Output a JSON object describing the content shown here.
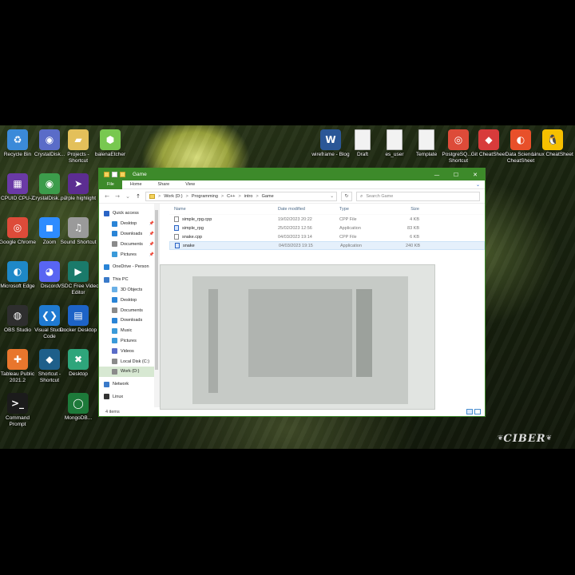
{
  "desktop": {
    "left_icons": [
      {
        "label": "Recycle Bin",
        "color": "#3b8ad9",
        "glyph": "♻"
      },
      {
        "label": "CrystalDisk...",
        "color": "#5a6cc8",
        "glyph": "◉"
      },
      {
        "label": "Projects - Shortcut",
        "color": "#e3c05a",
        "glyph": "▰"
      },
      {
        "label": "balenaEtcher",
        "color": "#78c850",
        "glyph": "⬢"
      },
      {
        "label": "CPUID CPU-Z",
        "color": "#6a3aa6",
        "glyph": "▦"
      },
      {
        "label": "CrystalDisk... 7",
        "color": "#3c9c4b",
        "glyph": "◉"
      },
      {
        "label": "purple highlight",
        "color": "#5c2d91",
        "glyph": "➤"
      },
      {
        "label": "Google Chrome",
        "color": "#dd4b39",
        "glyph": "◎"
      },
      {
        "label": "Zoom",
        "color": "#2d8cff",
        "glyph": "◼"
      },
      {
        "label": "Sound Shortcut",
        "color": "#9a9a9a",
        "glyph": "♫"
      },
      {
        "label": "Microsoft Edge",
        "color": "#1e88c8",
        "glyph": "◐"
      },
      {
        "label": "Discord",
        "color": "#5865f2",
        "glyph": "◕"
      },
      {
        "label": "VSDC Free Video Editor",
        "color": "#1a7a6a",
        "glyph": "▶"
      },
      {
        "label": "OBS Studio",
        "color": "#2e2e2e",
        "glyph": "◍"
      },
      {
        "label": "Visual Studio Code",
        "color": "#1f7ad1",
        "glyph": "❮❯"
      },
      {
        "label": "Docker Desktop",
        "color": "#1d63c7",
        "glyph": "▤"
      },
      {
        "label": "Tableau Public 2021.2",
        "color": "#e8762d",
        "glyph": "✚"
      },
      {
        "label": "Shortcut - Shortcut",
        "color": "#1e5f8a",
        "glyph": "◆"
      },
      {
        "label": "Desktop",
        "color": "#2ea57b",
        "glyph": "✖"
      },
      {
        "label": "Command Prompt",
        "color": "#1b1b1b",
        "glyph": ">_"
      },
      {
        "label": "MongoDB...",
        "color": "#1d7a3a",
        "glyph": "◯"
      }
    ],
    "right_icons": [
      {
        "label": "wireframe - Blog",
        "color": "#2b5797",
        "glyph": "W"
      },
      {
        "label": "Draft",
        "color": "#f2f2f2",
        "glyph": ""
      },
      {
        "label": "es_user",
        "color": "#f2f2f2",
        "glyph": ""
      },
      {
        "label": "Template",
        "color": "#f2f2f2",
        "glyph": ""
      },
      {
        "label": "PostgreSQ... - Shortcut",
        "color": "#dd4b39",
        "glyph": "◎"
      },
      {
        "label": "Git CheatSheet",
        "color": "#d83b3b",
        "glyph": "◆"
      },
      {
        "label": "Data Science CheatSheet",
        "color": "#e8502a",
        "glyph": "◐"
      },
      {
        "label": "Linux CheatSheet",
        "color": "#f6c000",
        "glyph": "🐧"
      }
    ],
    "watermark": "CIBER"
  },
  "window": {
    "title": "Game",
    "controls": {
      "minimize": "—",
      "maximize": "☐",
      "close": "✕"
    },
    "ribbon": {
      "file": "File",
      "home": "Home",
      "share": "Share",
      "view": "View",
      "expand": "⌄"
    },
    "address": {
      "back": "←",
      "forward": "→",
      "recent": "⌄",
      "up": "↑",
      "crumbs": [
        "Work (D:)",
        "Programming",
        "C++",
        "intro",
        "Game"
      ],
      "separator": ">",
      "dropdown": "⌄",
      "refresh": "↻",
      "search_icon": "⌕",
      "search_placeholder": "Search Game"
    },
    "nav_pane": [
      {
        "label": "Quick access",
        "color": "#2a64c5",
        "pinned": false,
        "indent": 0,
        "selected": false
      },
      {
        "label": "Desktop",
        "color": "#2a84d6",
        "pinned": true,
        "indent": 1,
        "selected": false
      },
      {
        "label": "Downloads",
        "color": "#2a84d6",
        "pinned": true,
        "indent": 1,
        "selected": false
      },
      {
        "label": "Documents",
        "color": "#8a8a8a",
        "pinned": true,
        "indent": 1,
        "selected": false
      },
      {
        "label": "Pictures",
        "color": "#3a9ad9",
        "pinned": true,
        "indent": 1,
        "selected": false
      },
      {
        "label": "OneDrive - Person",
        "color": "#2a84d6",
        "pinned": false,
        "indent": 0,
        "selected": false
      },
      {
        "label": "This PC",
        "color": "#3a7ac9",
        "pinned": false,
        "indent": 0,
        "selected": false
      },
      {
        "label": "3D Objects",
        "color": "#6ab0e6",
        "pinned": false,
        "indent": 1,
        "selected": false
      },
      {
        "label": "Desktop",
        "color": "#2a84d6",
        "pinned": false,
        "indent": 1,
        "selected": false
      },
      {
        "label": "Documents",
        "color": "#8a8a8a",
        "pinned": false,
        "indent": 1,
        "selected": false
      },
      {
        "label": "Downloads",
        "color": "#2a84d6",
        "pinned": false,
        "indent": 1,
        "selected": false
      },
      {
        "label": "Music",
        "color": "#3a9ad9",
        "pinned": false,
        "indent": 1,
        "selected": false
      },
      {
        "label": "Pictures",
        "color": "#3a9ad9",
        "pinned": false,
        "indent": 1,
        "selected": false
      },
      {
        "label": "Videos",
        "color": "#5a6cc8",
        "pinned": false,
        "indent": 1,
        "selected": false
      },
      {
        "label": "Local Disk (C:)",
        "color": "#8a8a8a",
        "pinned": false,
        "indent": 1,
        "selected": false
      },
      {
        "label": "Work (D:)",
        "color": "#8a8a8a",
        "pinned": false,
        "indent": 1,
        "selected": true
      },
      {
        "label": "Network",
        "color": "#3a7ac9",
        "pinned": false,
        "indent": 0,
        "selected": false
      },
      {
        "label": "Linux",
        "color": "#333333",
        "pinned": false,
        "indent": 0,
        "selected": false
      }
    ],
    "columns": {
      "name": "Name",
      "date": "Date modified",
      "type": "Type",
      "size": "Size"
    },
    "files": [
      {
        "name": "simple_rpg.cpp",
        "date": "19/02/2023 20:22",
        "type": "CPP File",
        "size": "4 KB",
        "kind": "file",
        "selected": false
      },
      {
        "name": "simple_rpg",
        "date": "25/02/2023 12:56",
        "type": "Application",
        "size": "83 KB",
        "kind": "app",
        "selected": false
      },
      {
        "name": "snake.cpp",
        "date": "04/03/2023 19:14",
        "type": "CPP File",
        "size": "6 KB",
        "kind": "file",
        "selected": false
      },
      {
        "name": "snake",
        "date": "04/03/2023 19:15",
        "type": "Application",
        "size": "240 KB",
        "kind": "app",
        "selected": true
      }
    ],
    "status": {
      "items": "4 items"
    },
    "accent": "#3d8a2a"
  }
}
